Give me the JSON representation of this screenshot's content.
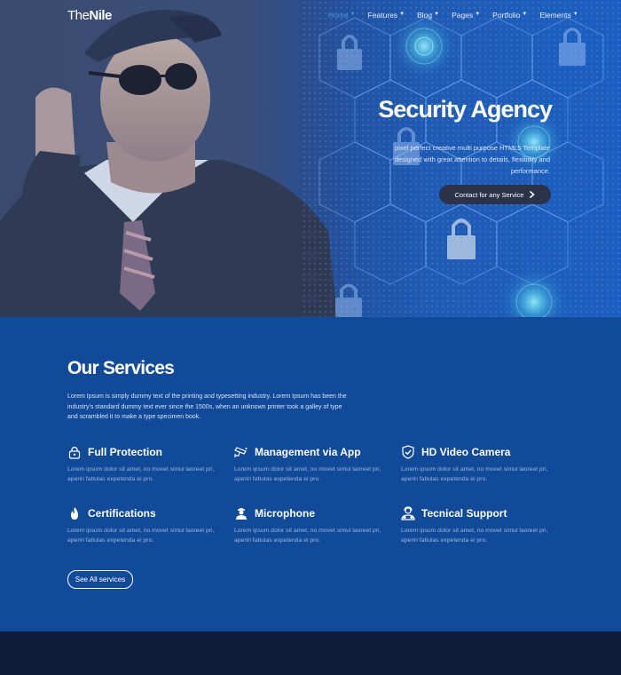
{
  "brand": {
    "logo_light": "The",
    "logo_bold": "Nile"
  },
  "nav": {
    "items": [
      {
        "label": "Home",
        "active": true
      },
      {
        "label": "Features",
        "active": false
      },
      {
        "label": "Blog",
        "active": false
      },
      {
        "label": "Pages",
        "active": false
      },
      {
        "label": "Portfolio",
        "active": false
      },
      {
        "label": "Elements",
        "active": false
      }
    ]
  },
  "hero": {
    "title": "Security Agency",
    "description": "pixel perfect creative multi purpose HTML5 Template designed with great attention to details, flexibility and performance.",
    "cta_label": "Contact for any Service",
    "cta_icon": "chevron-right-icon"
  },
  "services": {
    "title": "Our Services",
    "intro": "Lorem Ipsum is simply dummy text of the printing and typesetting industry. Lorem Ipsum has been the industry's standard dummy text ever since the 1500s, when an unknown printer took a galley of type and scrambled it to make a type specimen book.",
    "items": [
      {
        "name": "Full Protection",
        "icon": "lock-icon",
        "text": "Lorem ipsum dolor sit amet, no movet simul laoreet pri, aperiri fabulas expetenda ei pro."
      },
      {
        "name": "Management via App",
        "icon": "cctv-camera-icon",
        "text": "Lorem ipsum dolor sit amet, no movet simul laoreet pri, aperiri fabulas expetenda ei pro."
      },
      {
        "name": "HD Video Camera",
        "icon": "shield-check-icon",
        "text": "Lorem ipsum dolor sit amet, no movet simul laoreet pri, aperiri fabulas expetenda ei pro."
      },
      {
        "name": "Certifications",
        "icon": "flame-icon",
        "text": "Lorem ipsum dolor sit amet, no movet simul laoreet pri, aperiri fabulas expetenda ei pro."
      },
      {
        "name": "Microphone",
        "icon": "security-guard-icon",
        "text": "Lorem ipsum dolor sit amet, no movet simul laoreet pri, aperiri fabulas expetenda ei pro."
      },
      {
        "name": "Tecnical Support",
        "icon": "support-agent-icon",
        "text": "Lorem ipsum dolor sit amet, no movet simul laoreet pri, aperiri fabulas expetenda ei pro."
      }
    ],
    "see_all_label": "See All services"
  },
  "colors": {
    "services_bg": "#124a9a",
    "nav_active": "#4f8fe6",
    "footer_bg": "#0d1a38",
    "cta_bg": "#2c3348"
  }
}
